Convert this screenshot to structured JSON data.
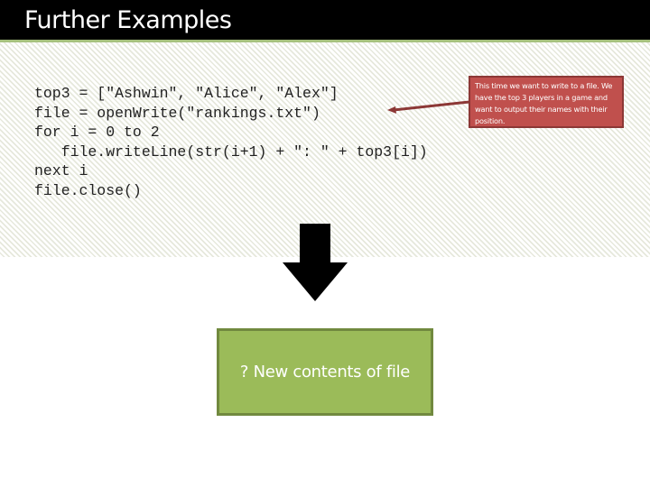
{
  "slide": {
    "title": "Further Examples",
    "code_lines": [
      "top3 = [\"Ashwin\", \"Alice\", \"Alex\"]",
      "file = openWrite(\"rankings.txt\")",
      "for i = 0 to 2",
      "   file.writeLine(str(i+1) + \": \" + top3[i])",
      "next i",
      "file.close()"
    ],
    "callout_note": "This time we want to write to a file. We have the top 3 players in a game and want to output their names with their position.",
    "arrow_icon": "down-arrow",
    "result_box_label": "? New contents of file",
    "colors": {
      "title_bar": "#000000",
      "accent_rule": "#a6c17e",
      "callout_fill": "#c0504d",
      "callout_border": "#8c3836",
      "result_fill": "#9bbb59",
      "result_border": "#71893f"
    }
  }
}
